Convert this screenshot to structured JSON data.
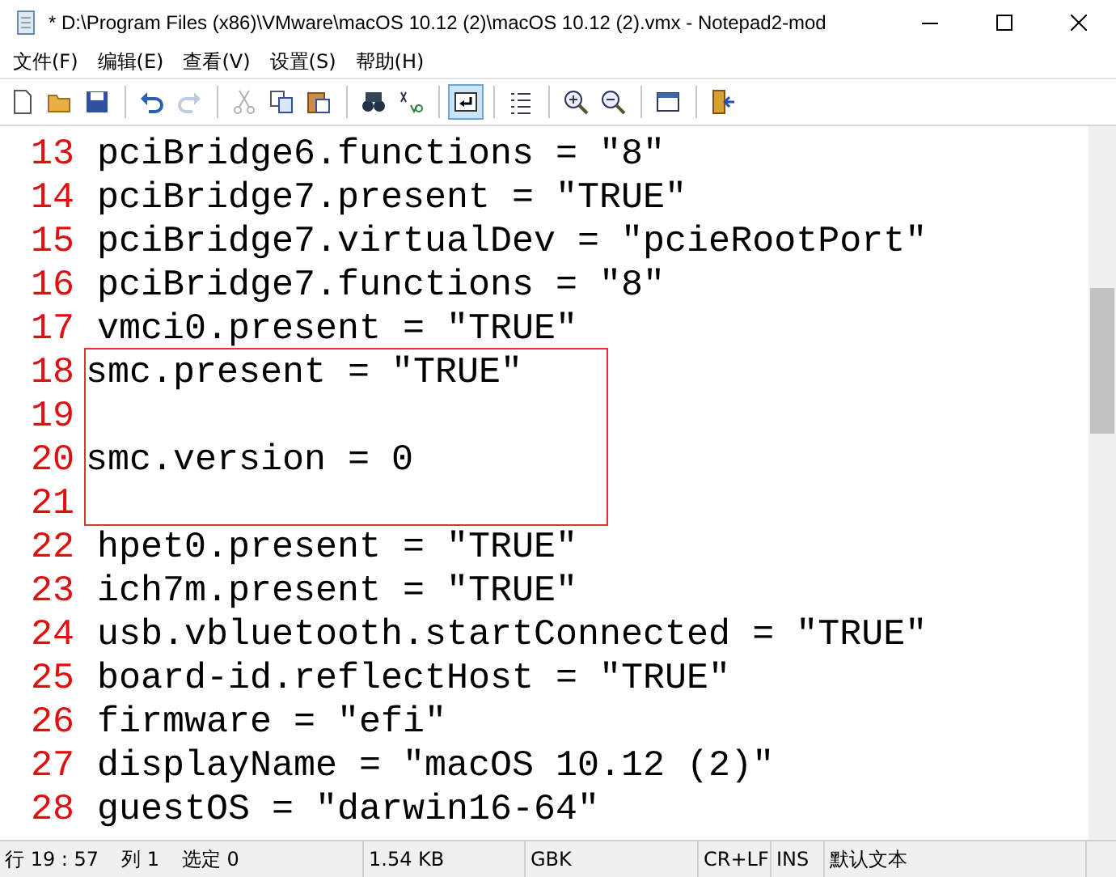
{
  "window": {
    "title": "* D:\\Program Files (x86)\\VMware\\macOS 10.12 (2)\\macOS 10.12 (2).vmx - Notepad2-mod"
  },
  "menu": [
    "文件(F)",
    "编辑(E)",
    "查看(V)",
    "设置(S)",
    "帮助(H)"
  ],
  "toolbar": [
    {
      "kind": "new",
      "disabled": false,
      "selected": false
    },
    {
      "kind": "open",
      "disabled": false,
      "selected": false
    },
    {
      "kind": "save",
      "disabled": false,
      "selected": false
    },
    {
      "kind": "sep"
    },
    {
      "kind": "undo",
      "disabled": false,
      "selected": false
    },
    {
      "kind": "redo",
      "disabled": true,
      "selected": false
    },
    {
      "kind": "sep"
    },
    {
      "kind": "cut",
      "disabled": true,
      "selected": false
    },
    {
      "kind": "copy",
      "disabled": false,
      "selected": false
    },
    {
      "kind": "paste",
      "disabled": false,
      "selected": false
    },
    {
      "kind": "sep"
    },
    {
      "kind": "find",
      "disabled": false,
      "selected": false
    },
    {
      "kind": "replace",
      "disabled": false,
      "selected": false
    },
    {
      "kind": "sep"
    },
    {
      "kind": "wrap",
      "disabled": false,
      "selected": true
    },
    {
      "kind": "sep"
    },
    {
      "kind": "list",
      "disabled": false,
      "selected": false
    },
    {
      "kind": "sep"
    },
    {
      "kind": "zoomin",
      "disabled": false,
      "selected": false
    },
    {
      "kind": "zoomout",
      "disabled": false,
      "selected": false
    },
    {
      "kind": "sep"
    },
    {
      "kind": "scheme",
      "disabled": false,
      "selected": false
    },
    {
      "kind": "sep"
    },
    {
      "kind": "exit",
      "disabled": false,
      "selected": false
    }
  ],
  "editor": {
    "lines": [
      {
        "number": "13",
        "text": "pciBridge6.functions = \"8\"",
        "boxed": false
      },
      {
        "number": "14",
        "text": "pciBridge7.present = \"TRUE\"",
        "boxed": false
      },
      {
        "number": "15",
        "text": "pciBridge7.virtualDev = \"pcieRootPort\"",
        "boxed": false
      },
      {
        "number": "16",
        "text": "pciBridge7.functions = \"8\"",
        "boxed": false
      },
      {
        "number": "17",
        "text": "vmci0.present = \"TRUE\"",
        "boxed": false
      },
      {
        "number": "18",
        "text": "smc.present = \"TRUE\"",
        "boxed": true
      },
      {
        "number": "19",
        "boxed": true
      },
      {
        "number": "20",
        "text": "smc.version = 0",
        "boxed": true
      },
      {
        "number": "21",
        "boxed": true
      },
      {
        "number": "22",
        "text": "hpet0.present = \"TRUE\"",
        "boxed": false
      },
      {
        "number": "23",
        "text": "ich7m.present = \"TRUE\"",
        "boxed": false
      },
      {
        "number": "24",
        "text": "usb.vbluetooth.startConnected = \"TRUE\"",
        "boxed": false
      },
      {
        "number": "25",
        "text": "board-id.reflectHost = \"TRUE\"",
        "boxed": false
      },
      {
        "number": "26",
        "text": "firmware = \"efi\"",
        "boxed": false
      },
      {
        "number": "27",
        "text": "displayName = \"macOS 10.12 (2)\"",
        "boxed": false
      },
      {
        "number": "28",
        "text": "guestOS = \"darwin16-64\"",
        "boxed": false
      }
    ]
  },
  "status_bar": [
    {
      "texts": [
        "行 19 : 57",
        "列 1",
        "选定 0"
      ]
    },
    {
      "texts": [
        "1.54 KB"
      ]
    },
    {
      "texts": [
        "GBK"
      ]
    },
    {
      "texts": [
        "CR+LF"
      ]
    },
    {
      "texts": [
        "INS"
      ]
    },
    {
      "texts": [
        "默认文本"
      ]
    }
  ]
}
